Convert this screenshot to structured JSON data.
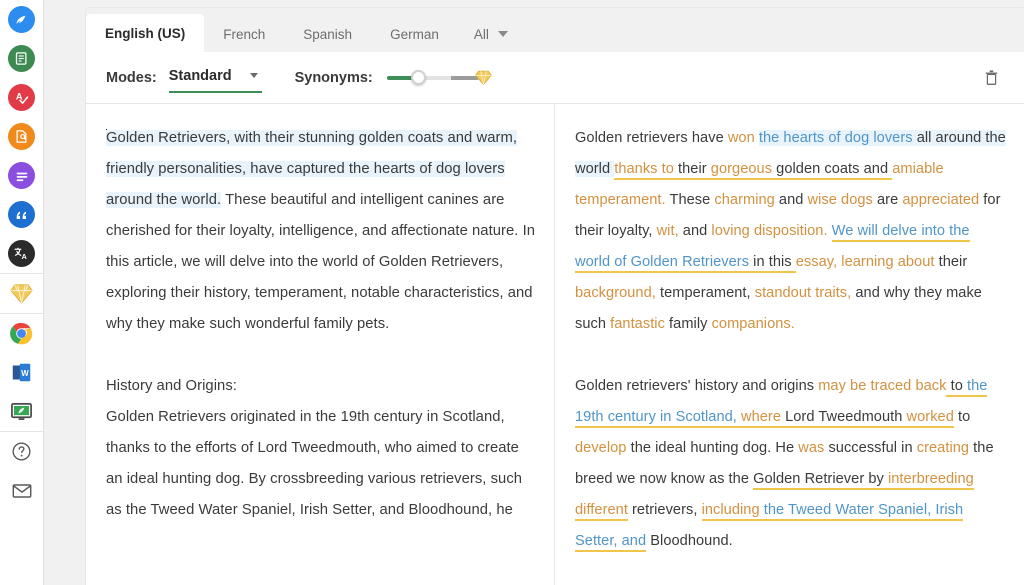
{
  "rail": {
    "items": [
      {
        "name": "paraphraser-icon",
        "label": "Paraphraser",
        "color": "#2d8cf0",
        "glyph": "quill"
      },
      {
        "name": "summarizer-icon",
        "label": "Summarizer",
        "color": "#3d8b52",
        "glyph": "doc-lines"
      },
      {
        "name": "grammar-checker-icon",
        "label": "Grammar Checker",
        "color": "#e03b46",
        "glyph": "a-check"
      },
      {
        "name": "plagiarism-checker-icon",
        "label": "Plagiarism Checker",
        "color": "#f08a1d",
        "glyph": "doc-search"
      },
      {
        "name": "co-writer-icon",
        "label": "Co-Writer",
        "color": "#8b4fe0",
        "glyph": "lines"
      },
      {
        "name": "citation-generator-icon",
        "label": "Citation Generator",
        "color": "#1f6fd0",
        "glyph": "quote"
      },
      {
        "name": "translator-icon",
        "label": "Translator",
        "color": "#2b2b2b",
        "glyph": "translate"
      }
    ],
    "premium": {
      "name": "premium-diamond-icon",
      "label": "Premium",
      "color": "#f0c24a"
    },
    "apps": [
      {
        "name": "chrome-extension-icon",
        "label": "Chrome Extension"
      },
      {
        "name": "ms-word-addin-icon",
        "label": "MS Word Add-in"
      },
      {
        "name": "desktop-app-icon",
        "label": "Desktop App"
      }
    ],
    "footer": [
      {
        "name": "help-icon",
        "label": "Help"
      },
      {
        "name": "mail-icon",
        "label": "Contact"
      }
    ]
  },
  "tabs": {
    "items": [
      {
        "label": "English (US)",
        "active": true
      },
      {
        "label": "French",
        "active": false
      },
      {
        "label": "Spanish",
        "active": false
      },
      {
        "label": "German",
        "active": false
      }
    ],
    "all_label": "All"
  },
  "toolbar": {
    "modes_label": "Modes:",
    "mode_value": "Standard",
    "synonyms_label": "Synonyms:",
    "slider_value": 25,
    "delete_label": "Delete"
  },
  "input_text": {
    "paragraph1_selected": "Golden Retrievers, with their stunning golden coats and warm, friendly personalities, have captured the hearts of dog lovers around the world.",
    "paragraph1_rest": " These beautiful and intelligent canines are cherished for their loyalty, intelligence, and affectionate nature. In this article, we will delve into the world of Golden Retrievers, exploring their history, temperament, notable characteristics, and why they make such wonderful family pets.",
    "heading2": "History and Origins:",
    "paragraph2": "Golden Retrievers originated in the 19th century in Scotland, thanks to the efforts of Lord Tweedmouth, who aimed to create an ideal hunting dog. By crossbreeding various retrievers, such as the Tweed Water Spaniel, Irish Setter, and Bloodhound, he"
  },
  "output_text": {
    "p1": {
      "s1": "Golden retrievers have ",
      "s2": "won",
      "s3": " ",
      "s4": "the hearts of dog lovers",
      "s5": " all around the world ",
      "s6": "thanks to",
      "s7": " their ",
      "s8": "gorgeous",
      "s9": " golden coats and ",
      "s10": "amiable temperament.",
      "s11": " These ",
      "s12": "charming",
      "s13": " and ",
      "s14": "wise dogs",
      "s15": " are ",
      "s16": "appreciated",
      "s17": " for their loyalty, ",
      "s18": "wit,",
      "s19": " and ",
      "s20": "loving disposition.",
      "s21": " ",
      "s22": "We will delve into the world of Golden Retrievers",
      "s23": " in this ",
      "s24": "essay,",
      "s25": " ",
      "s26": "learning about",
      "s27": " their ",
      "s28": "background,",
      "s29": " temperament, ",
      "s30": "standout traits,",
      "s31": " and why they make such ",
      "s32": "fantastic",
      "s33": " family ",
      "s34": "companions."
    },
    "p2": {
      "s1": "Golden retrievers' history and origins ",
      "s2": "may be traced back",
      "s3": " to ",
      "s4": "the 19th century in Scotland,",
      "s5": " ",
      "s6": "where",
      "s7": " Lord Tweedmouth ",
      "s8": "worked",
      "s9": " to ",
      "s10": "develop",
      "s11": " the ideal hunting dog. He ",
      "s12": "was",
      "s13": " successful in ",
      "s14": "creating",
      "s15": " the breed we now know as the ",
      "s16": "Golden Retriever",
      "s17": " by ",
      "s18": "interbreeding different",
      "s19": " retrievers, ",
      "s20": "including",
      "s21": " ",
      "s22": "the Tweed Water Spaniel, Irish Setter, and",
      "s23": " Bloodhound."
    }
  },
  "colors": {
    "orange": "#d3913f",
    "blue": "#5095c8",
    "underline_gold": "#f0c64a",
    "highlight_blue": "#e9f3fb",
    "accent_green": "#3e8e5a"
  }
}
